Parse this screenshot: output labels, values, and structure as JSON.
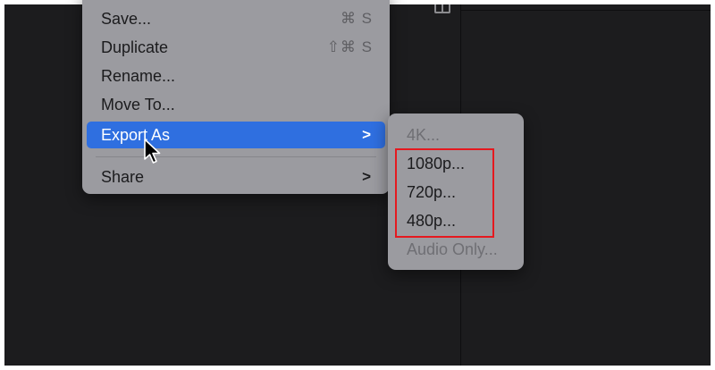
{
  "menu": {
    "items": [
      {
        "label": "Save...",
        "shortcut": "⌘ S"
      },
      {
        "label": "Duplicate",
        "shortcut": "⇧⌘ S"
      },
      {
        "label": "Rename..."
      },
      {
        "label": "Move To..."
      },
      {
        "label": "Export As",
        "submenu_indicator": ">",
        "state": "highlighted"
      },
      {
        "label": "Share",
        "submenu_indicator": ">"
      }
    ]
  },
  "submenu": {
    "items": [
      {
        "label": "4K...",
        "enabled": false
      },
      {
        "label": "1080p...",
        "enabled": true
      },
      {
        "label": "720p...",
        "enabled": true
      },
      {
        "label": "480p...",
        "enabled": true
      },
      {
        "label": "Audio Only...",
        "enabled": false
      }
    ]
  },
  "colors": {
    "background": "#1c1c1e",
    "menu_bg": "#9b9ba0",
    "highlight": "#2f6fe0",
    "annotation_box": "#e5191f"
  },
  "icons": {
    "cursor": "arrow-cursor-icon",
    "window": "window-layout-icon"
  }
}
